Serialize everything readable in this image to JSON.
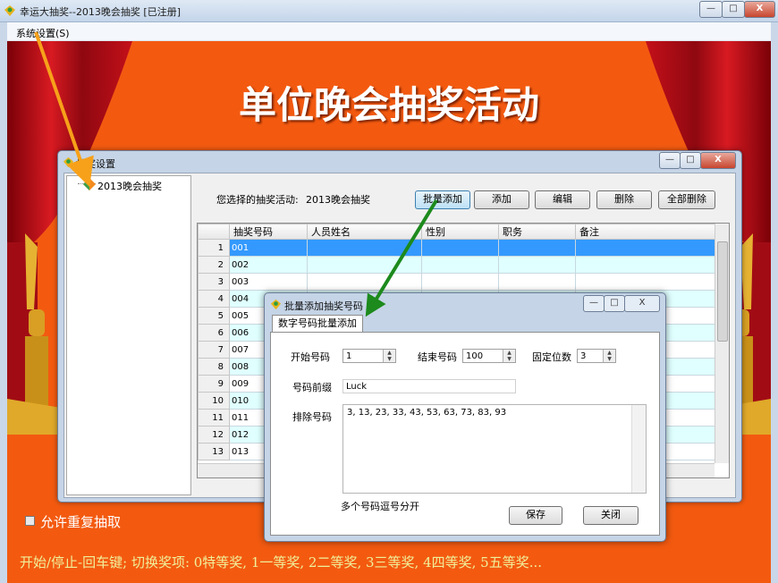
{
  "window": {
    "title": "幸运大抽奖--2013晚会抽奖 [已注册]",
    "controls": [
      "—",
      "□",
      "X"
    ]
  },
  "menu": {
    "system": "系统设置(S)"
  },
  "banner": {
    "title": "单位晚会抽奖活动"
  },
  "options": {
    "allow_repeat": "允许重复抽取"
  },
  "hint": "开始/停止-回车键; 切换奖项: 0特等奖, 1一等奖, 2二等奖, 3三等奖, 4四等奖, 5五等奖...",
  "settings": {
    "title": "抽奖设置",
    "tree_node": "2013晚会抽奖",
    "selected_label": "您选择的抽奖活动:",
    "selected_value": "2013晚会抽奖",
    "buttons": {
      "batch_add": "批量添加",
      "add": "添加",
      "edit": "编辑",
      "delete": "删除",
      "delete_all": "全部删除"
    },
    "columns": [
      "抽奖号码",
      "人员姓名",
      "性别",
      "职务",
      "备注"
    ],
    "rows": [
      {
        "n": "1",
        "code": "001"
      },
      {
        "n": "2",
        "code": "002"
      },
      {
        "n": "3",
        "code": "003"
      },
      {
        "n": "4",
        "code": "004"
      },
      {
        "n": "5",
        "code": "005"
      },
      {
        "n": "6",
        "code": "006"
      },
      {
        "n": "7",
        "code": "007"
      },
      {
        "n": "8",
        "code": "008"
      },
      {
        "n": "9",
        "code": "009"
      },
      {
        "n": "10",
        "code": "010"
      },
      {
        "n": "11",
        "code": "011"
      },
      {
        "n": "12",
        "code": "012"
      },
      {
        "n": "13",
        "code": "013"
      }
    ]
  },
  "batch": {
    "title": "批量添加抽奖号码",
    "tab": "数字号码批量添加",
    "start_label": "开始号码",
    "start_value": "1",
    "end_label": "结束号码",
    "end_value": "100",
    "digits_label": "固定位数",
    "digits_value": "3",
    "prefix_label": "号码前缀",
    "prefix_value": "Luck",
    "exclude_label": "排除号码",
    "exclude_value": "3, 13, 23, 33, 43, 53, 63, 73, 83, 93",
    "note": "多个号码逗号分开",
    "save": "保存",
    "close": "关闭"
  },
  "colors": {
    "stage": "#f35a10",
    "curtain": "#c4101a",
    "arrow_orange": "#f7a11a",
    "arrow_green": "#1c8a1c",
    "selected_row": "#3399ff"
  }
}
